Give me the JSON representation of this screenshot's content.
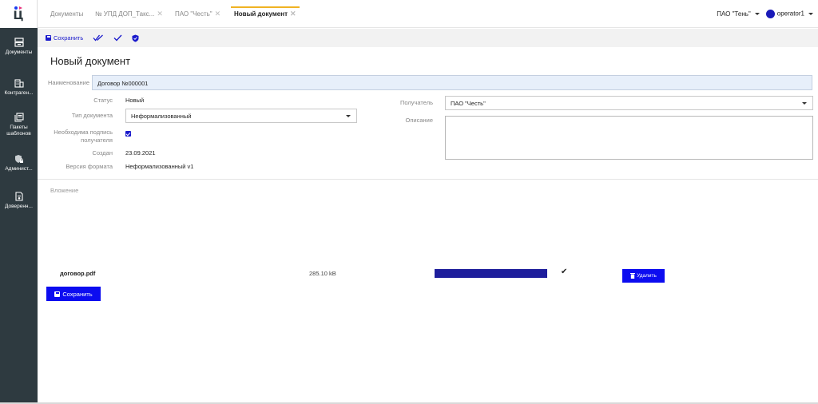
{
  "tabs": [
    {
      "label": "Документы"
    },
    {
      "label": "№ УПД ДОП_Такс..."
    },
    {
      "label": "ПАО \"Честь\""
    },
    {
      "label": "Новый документ"
    }
  ],
  "header": {
    "org": "ПАО \"Тень\"",
    "user": "operator1"
  },
  "sidebar": {
    "items": [
      {
        "label": "Документы"
      },
      {
        "label": "Контраген..."
      },
      {
        "label": "Пакеты шаблонов"
      },
      {
        "label": "Админист..."
      },
      {
        "label": "Доверенн..."
      }
    ]
  },
  "toolbar": {
    "save_label": "Сохранить"
  },
  "page": {
    "title": "Новый документ"
  },
  "form": {
    "name_label": "Наименование",
    "name_value": "Договор №000001",
    "status_label": "Статус",
    "status_value": "Новый",
    "doctype_label": "Тип документа",
    "doctype_value": "Неформализованный",
    "sign_label": "Необходима подпись получателя",
    "sign_checked": true,
    "created_label": "Создан",
    "created_value": "23.09.2021",
    "format_label": "Версия формата",
    "format_value": "Неформализованный v1",
    "recipient_label": "Получатель",
    "recipient_value": "ПАО \"Честь\"",
    "description_label": "Описание",
    "description_value": ""
  },
  "attachment": {
    "title": "Вложение",
    "file_name": "договор.pdf",
    "file_size": "285.10 kB",
    "progress_percent": 100,
    "delete_label": "Удалить"
  },
  "footer": {
    "save_label": "Сохранить"
  },
  "colors": {
    "accent": "#0c0cf0",
    "sidebar": "#2e3a40",
    "tab_active": "#f0b323"
  }
}
